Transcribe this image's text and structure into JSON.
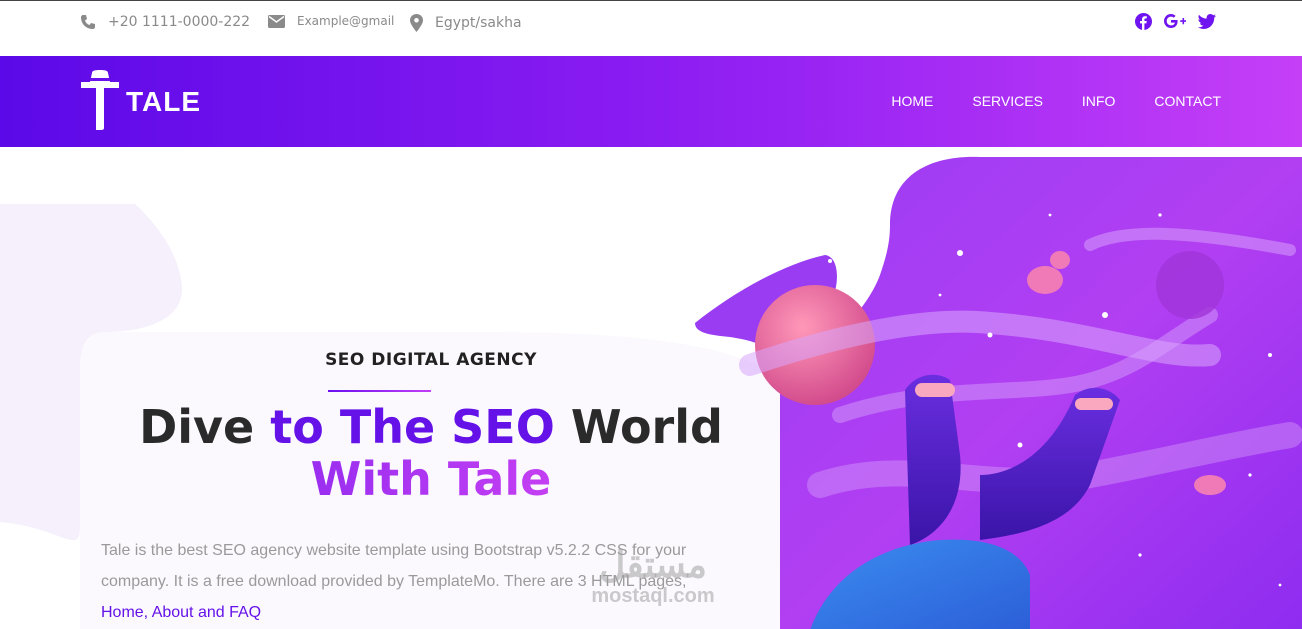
{
  "topbar": {
    "phone": "+20 1111-0000-222",
    "email": "Example@gmail",
    "location": "Egypt/sakha",
    "social_icons": [
      "facebook-icon",
      "google-plus-icon",
      "twitter-icon"
    ]
  },
  "brand": {
    "name": "TALE"
  },
  "nav": {
    "items": [
      "HOME",
      "SERVICES",
      "INFO",
      "CONTACT"
    ]
  },
  "hero": {
    "eyebrow": "SEO DIGITAL AGENCY",
    "headline_a": "Dive ",
    "headline_b": "to The SEO",
    "headline_c": " World",
    "headline_line2": "With Tale",
    "description": "Tale is the best SEO agency website template using Bootstrap v5.2.2 CSS for your company. It is a free download provided by TemplateMo. There are 3 HTML pages,",
    "link_text": "Home, About and FAQ"
  },
  "watermark": {
    "arabic": "مستقل",
    "latin": "mostaql.com"
  },
  "colors": {
    "accent": "#6512e8",
    "gradient_start": "#5b09e8",
    "gradient_end": "#c53ff7",
    "muted_text": "#9a9a9a"
  }
}
